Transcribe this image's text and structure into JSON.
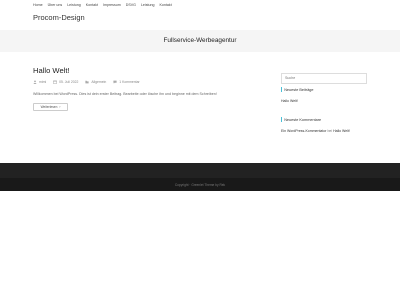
{
  "nav": {
    "items": [
      "Home",
      "Über uns",
      "Leistung",
      "Kontakt",
      "Impressum",
      "DSVG",
      "Leistung",
      "Kontakt"
    ]
  },
  "site": {
    "name": "Procom-Design"
  },
  "hero": {
    "title": "Fullservice-Werbeagentur"
  },
  "post": {
    "title": "Hallo Welt!",
    "meta": {
      "author": "mimi",
      "date": "05. Juli 2022",
      "category": "Allgemein",
      "comments": "1 Kommentar"
    },
    "excerpt": "Willkommen bei WordPress. Dies ist dein erster Beitrag. Bearbeite oder lösche ihn und beginne mit dem Schreiben!",
    "read_more": "Weiterlesen"
  },
  "sidebar": {
    "search_placeholder": "Suche",
    "recent_posts_title": "Neueste Beiträge",
    "recent_posts": [
      "Hallo Welt!"
    ],
    "recent_comments_title": "Neueste Kommentare",
    "comment": {
      "author": "Ein WordPress-Kommentator",
      "conj": "bei",
      "post": "Hallo Welt!"
    }
  },
  "footer": {
    "copyright": "Copyright · Greenlet Theme by Rek"
  },
  "colors": {
    "accent": "#49bfd6",
    "footer_bg": "#222222",
    "hero_bg": "#f5f5f5"
  }
}
